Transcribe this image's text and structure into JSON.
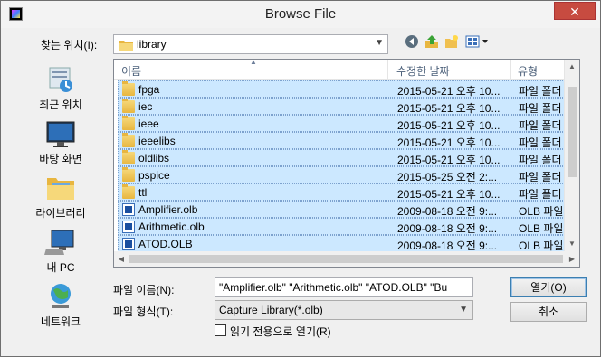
{
  "window": {
    "title": "Browse File",
    "close_glyph": "✕"
  },
  "toolbar": {
    "look_in_label": "찾는 위치(I):",
    "look_in_value": "library",
    "icons": [
      "back-icon",
      "up-folder-icon",
      "new-folder-icon",
      "view-menu-icon"
    ]
  },
  "places": [
    {
      "label": "최근 위치",
      "icon": "recent-places-icon"
    },
    {
      "label": "바탕 화면",
      "icon": "desktop-icon"
    },
    {
      "label": "라이브러리",
      "icon": "libraries-icon"
    },
    {
      "label": "내 PC",
      "icon": "computer-icon"
    },
    {
      "label": "네트워크",
      "icon": "network-icon"
    }
  ],
  "columns": {
    "name": "이름",
    "date": "수정한 날짜",
    "type": "유형"
  },
  "files": [
    {
      "name": "fpga",
      "date": "2015-05-21 오후 10...",
      "type": "파일 폴더",
      "kind": "folder"
    },
    {
      "name": "iec",
      "date": "2015-05-21 오후 10...",
      "type": "파일 폴더",
      "kind": "folder"
    },
    {
      "name": "ieee",
      "date": "2015-05-21 오후 10...",
      "type": "파일 폴더",
      "kind": "folder"
    },
    {
      "name": "ieeelibs",
      "date": "2015-05-21 오후 10...",
      "type": "파일 폴더",
      "kind": "folder"
    },
    {
      "name": "oldlibs",
      "date": "2015-05-21 오후 10...",
      "type": "파일 폴더",
      "kind": "folder"
    },
    {
      "name": "pspice",
      "date": "2015-05-25 오전 2:...",
      "type": "파일 폴더",
      "kind": "folder"
    },
    {
      "name": "ttl",
      "date": "2015-05-21 오후 10...",
      "type": "파일 폴더",
      "kind": "folder"
    },
    {
      "name": "Amplifier.olb",
      "date": "2009-08-18 오전 9:...",
      "type": "OLB 파일",
      "kind": "olb"
    },
    {
      "name": "Arithmetic.olb",
      "date": "2009-08-18 오전 9:...",
      "type": "OLB 파일",
      "kind": "olb"
    },
    {
      "name": "ATOD.OLB",
      "date": "2009-08-18 오전 9:...",
      "type": "OLB 파일",
      "kind": "olb"
    }
  ],
  "form": {
    "file_name_label": "파일 이름(N):",
    "file_name_value": "\"Amplifier.olb\" \"Arithmetic.olb\" \"ATOD.OLB\" \"Bu",
    "file_type_label": "파일 형식(T):",
    "file_type_value": "Capture Library(*.olb)",
    "read_only_label": "읽기 전용으로 열기(R)",
    "read_only_checked": false
  },
  "buttons": {
    "open": "열기(O)",
    "cancel": "취소"
  },
  "colors": {
    "selection": "#cce8ff",
    "selection_border": "#7da2ce",
    "close": "#c74b40"
  }
}
